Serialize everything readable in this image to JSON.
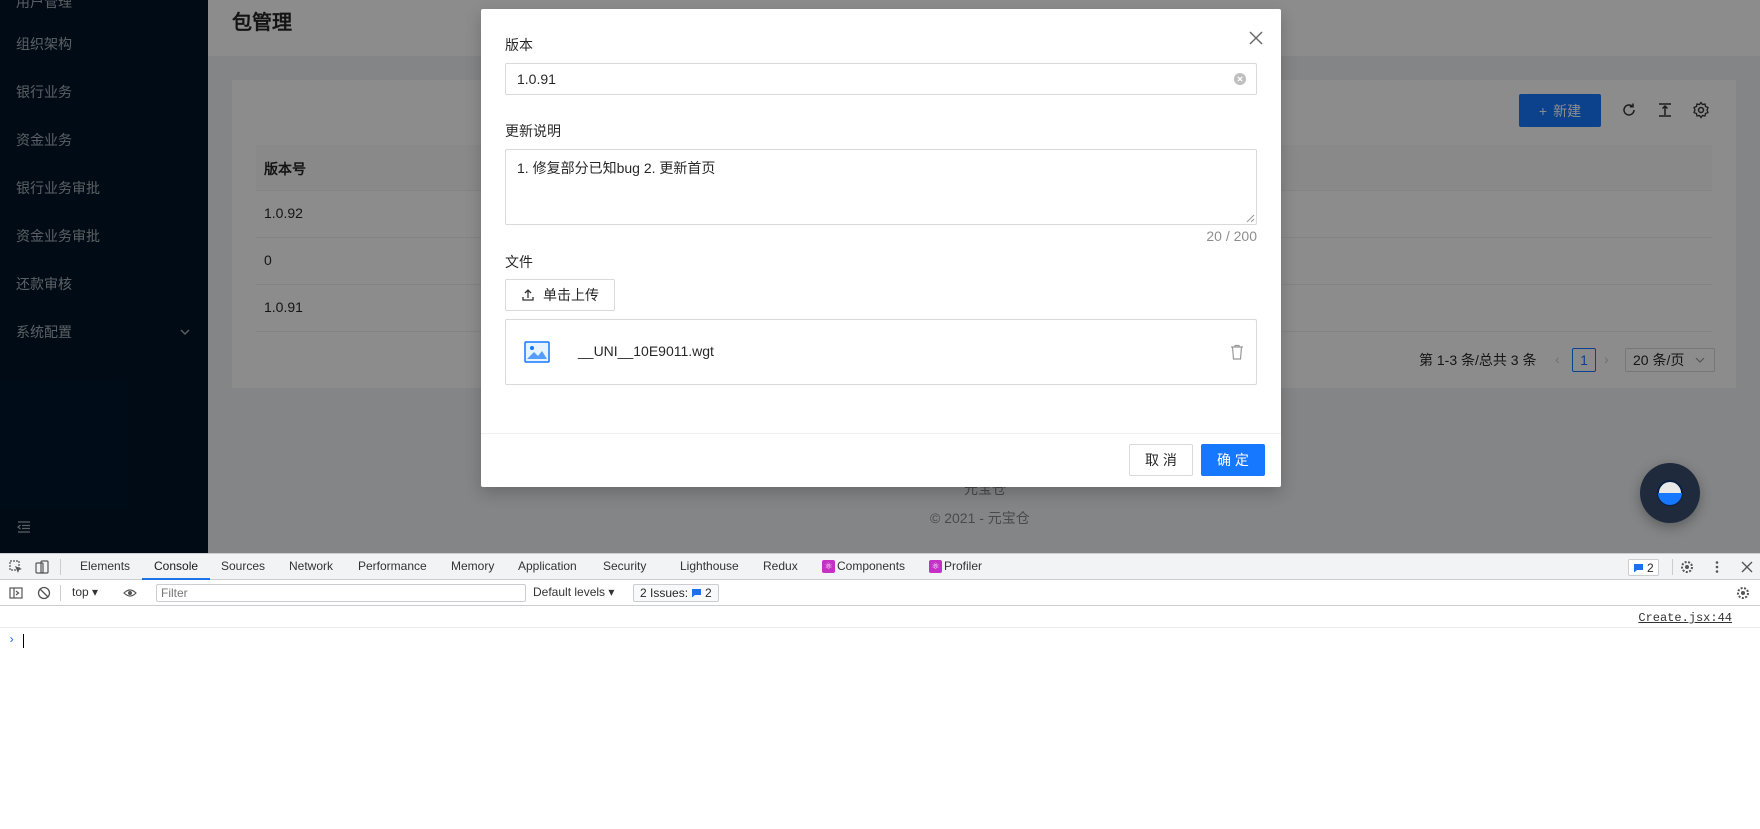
{
  "sidebar": {
    "items": [
      {
        "label": "用户管理"
      },
      {
        "label": "组织架构"
      },
      {
        "label": "银行业务"
      },
      {
        "label": "资金业务"
      },
      {
        "label": "银行业务审批"
      },
      {
        "label": "资金业务审批"
      },
      {
        "label": "还款审核"
      },
      {
        "label": "系统配置"
      }
    ]
  },
  "page": {
    "title": "包管理"
  },
  "toolbar": {
    "new_label": "新建"
  },
  "table": {
    "columns": [
      "版本号"
    ],
    "rows": [
      {
        "version": "1.0.92"
      },
      {
        "version": "0"
      },
      {
        "version": "1.0.91"
      }
    ]
  },
  "pagination": {
    "total_text": "第 1-3 条/总共 3 条",
    "current": "1",
    "page_size": "20 条/页"
  },
  "footer": {
    "partial": "元宝仓",
    "copyright": "© 2021 - 元宝仓"
  },
  "modal": {
    "version_label": "版本",
    "version_value": "1.0.91",
    "notes_label": "更新说明",
    "notes_value": "1. 修复部分已知bug 2. 更新首页",
    "char_count": "20 / 200",
    "file_label": "文件",
    "upload_label": "单击上传",
    "file_name": "__UNI__10E9011.wgt",
    "cancel_label": "取 消",
    "ok_label": "确 定"
  },
  "devtools": {
    "tabs": [
      "Elements",
      "Console",
      "Sources",
      "Network",
      "Performance",
      "Memory",
      "Application",
      "Security",
      "Lighthouse",
      "Redux",
      "Components",
      "Profiler"
    ],
    "active_tab": "Console",
    "issue_count": "2",
    "context": "top",
    "filter_placeholder": "Filter",
    "levels": "Default levels",
    "issues_label": "2 Issues:",
    "issues_count": "2",
    "source_link": "Create.jsx:44"
  },
  "colors": {
    "primary": "#1677ff",
    "sidebar_bg": "#001529",
    "mask": "rgba(0,0,0,0.45)"
  }
}
